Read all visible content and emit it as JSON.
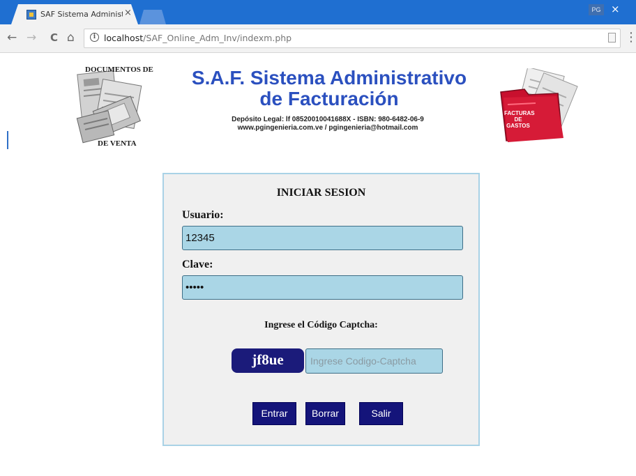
{
  "browser": {
    "tab_title": "SAF Sistema Administrati",
    "tab_close": "×",
    "profile_badge": "PG",
    "window_close": "×",
    "back": "←",
    "forward": "→",
    "reload": "C",
    "home": "⌂",
    "info": "i",
    "url_host": "localhost",
    "url_path": "/SAF_Online_Adm_Inv/indexm.php",
    "menu": "⋮"
  },
  "header": {
    "left_logo_top": "DOCUMENTOS DE",
    "left_logo_bottom": "DE VENTA",
    "title_line1": "S.A.F. Sistema Administrativo",
    "title_line2": "de Facturación",
    "legal_line1": "Depósito Legal: lf 08520010041688X - ISBN: 980-6482-06-9",
    "legal_line2": "www.pgingenieria.com.ve / pgingenieria@hotmail.com",
    "right_logo_text": "FACTURAS DE GASTOS"
  },
  "login": {
    "title": "INICIAR SESION",
    "user_label": "Usuario:",
    "user_value": "12345",
    "password_label": "Clave:",
    "password_value": "12345",
    "captcha_label": "Ingrese el Código Captcha:",
    "captcha_code": "jf8ue",
    "captcha_placeholder": "Ingrese Codigo-Captcha",
    "btn_enter": "Entrar",
    "btn_clear": "Borrar",
    "btn_exit": "Salir"
  },
  "colors": {
    "browser_blue": "#1f6fd1",
    "title_blue": "#2b50bf",
    "input_bg": "#aad6e6",
    "button_bg": "#14147a",
    "panel_border": "#a9d2e6"
  }
}
